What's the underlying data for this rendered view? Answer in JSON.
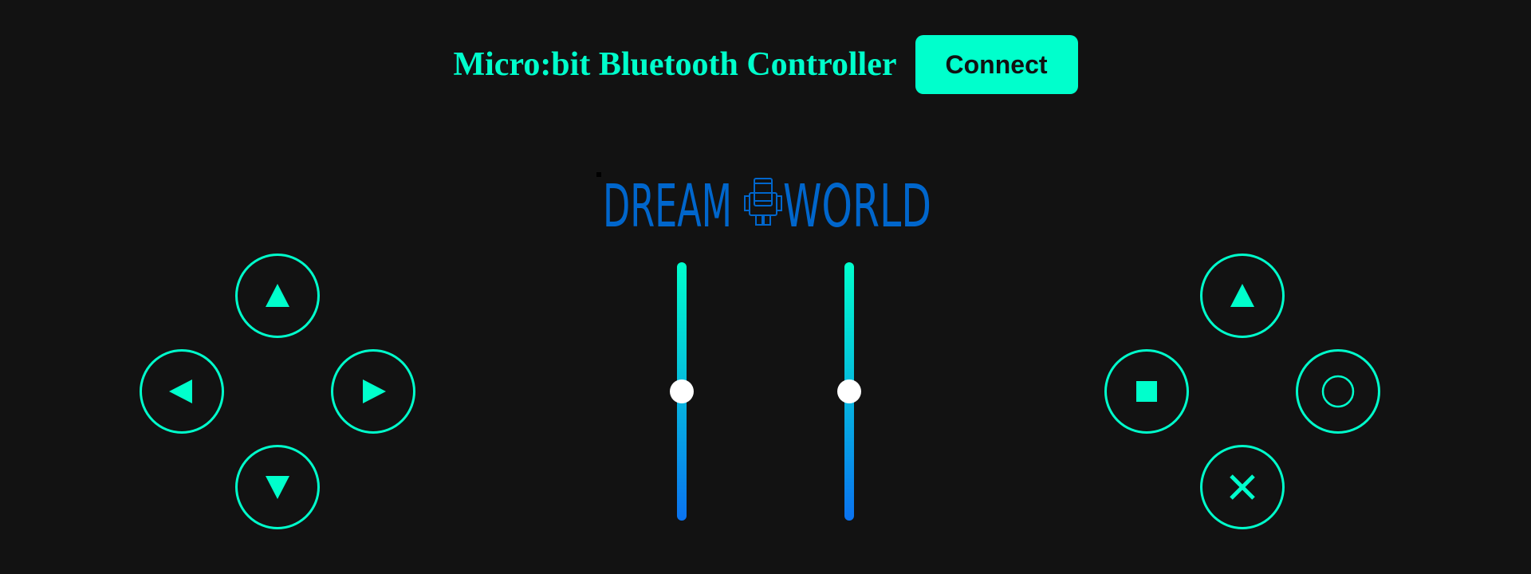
{
  "header": {
    "title": "Micro:bit Bluetooth Controller",
    "connect_label": "Connect"
  },
  "logo": {
    "text_left": "DREAM",
    "text_right": "WORLD",
    "color": "#0066cc"
  },
  "dpad": {
    "up_icon": "triangle-up-icon",
    "down_icon": "triangle-down-icon",
    "left_icon": "triangle-left-icon",
    "right_icon": "triangle-right-icon"
  },
  "action_buttons": {
    "triangle_icon": "triangle-icon",
    "square_icon": "square-icon",
    "circle_icon": "circle-icon",
    "cross_icon": "cross-icon"
  },
  "sliders": [
    {
      "name": "left-slider",
      "value_fraction": 0.5
    },
    {
      "name": "right-slider",
      "value_fraction": 0.5
    }
  ],
  "colors": {
    "accent": "#00ffcc",
    "background": "#121212",
    "slider_top": "#00ffcc",
    "slider_bottom": "#0a72f0",
    "thumb": "#ffffff"
  }
}
